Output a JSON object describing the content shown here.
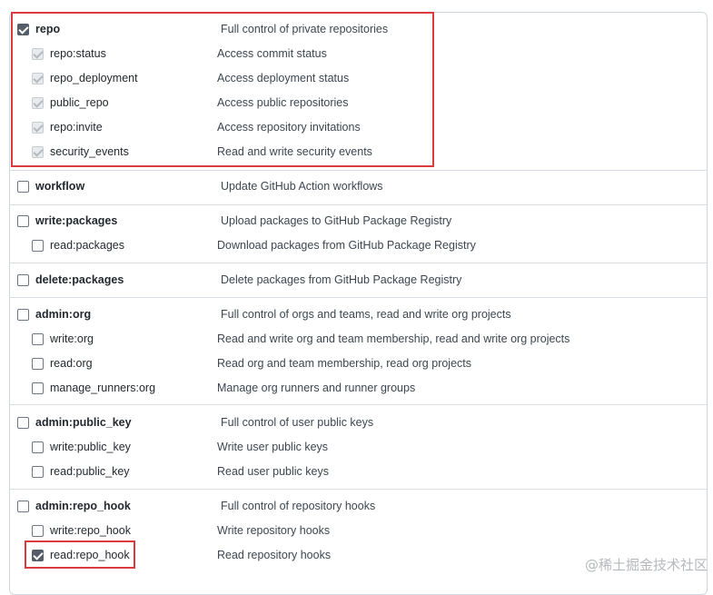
{
  "rows": [
    {
      "name": "repo",
      "desc": "Full control of private repositories",
      "checked": true,
      "disabled": false,
      "kind": "parent"
    },
    {
      "name": "repo:status",
      "desc": "Access commit status",
      "checked": true,
      "disabled": true,
      "kind": "child"
    },
    {
      "name": "repo_deployment",
      "desc": "Access deployment status",
      "checked": true,
      "disabled": true,
      "kind": "child"
    },
    {
      "name": "public_repo",
      "desc": "Access public repositories",
      "checked": true,
      "disabled": true,
      "kind": "child"
    },
    {
      "name": "repo:invite",
      "desc": "Access repository invitations",
      "checked": true,
      "disabled": true,
      "kind": "child"
    },
    {
      "name": "security_events",
      "desc": "Read and write security events",
      "checked": true,
      "disabled": true,
      "kind": "child"
    },
    {
      "name": "workflow",
      "desc": "Update GitHub Action workflows",
      "checked": false,
      "disabled": false,
      "kind": "parent"
    },
    {
      "name": "write:packages",
      "desc": "Upload packages to GitHub Package Registry",
      "checked": false,
      "disabled": false,
      "kind": "parent"
    },
    {
      "name": "read:packages",
      "desc": "Download packages from GitHub Package Registry",
      "checked": false,
      "disabled": false,
      "kind": "child"
    },
    {
      "name": "delete:packages",
      "desc": "Delete packages from GitHub Package Registry",
      "checked": false,
      "disabled": false,
      "kind": "parent"
    },
    {
      "name": "admin:org",
      "desc": "Full control of orgs and teams, read and write org projects",
      "checked": false,
      "disabled": false,
      "kind": "parent"
    },
    {
      "name": "write:org",
      "desc": "Read and write org and team membership, read and write org projects",
      "checked": false,
      "disabled": false,
      "kind": "child"
    },
    {
      "name": "read:org",
      "desc": "Read org and team membership, read org projects",
      "checked": false,
      "disabled": false,
      "kind": "child"
    },
    {
      "name": "manage_runners:org",
      "desc": "Manage org runners and runner groups",
      "checked": false,
      "disabled": false,
      "kind": "child"
    },
    {
      "name": "admin:public_key",
      "desc": "Full control of user public keys",
      "checked": false,
      "disabled": false,
      "kind": "parent"
    },
    {
      "name": "write:public_key",
      "desc": "Write user public keys",
      "checked": false,
      "disabled": false,
      "kind": "child"
    },
    {
      "name": "read:public_key",
      "desc": "Read user public keys",
      "checked": false,
      "disabled": false,
      "kind": "child"
    },
    {
      "name": "admin:repo_hook",
      "desc": "Full control of repository hooks",
      "checked": false,
      "disabled": false,
      "kind": "parent"
    },
    {
      "name": "write:repo_hook",
      "desc": "Write repository hooks",
      "checked": false,
      "disabled": false,
      "kind": "child"
    },
    {
      "name": "read:repo_hook",
      "desc": "Read repository hooks",
      "checked": true,
      "disabled": false,
      "kind": "child"
    }
  ],
  "watermark": "@稀土掘金技术社区",
  "colors": {
    "highlight": "#dc3b3d",
    "checked": "#545d68",
    "border": "#d0d7de"
  }
}
